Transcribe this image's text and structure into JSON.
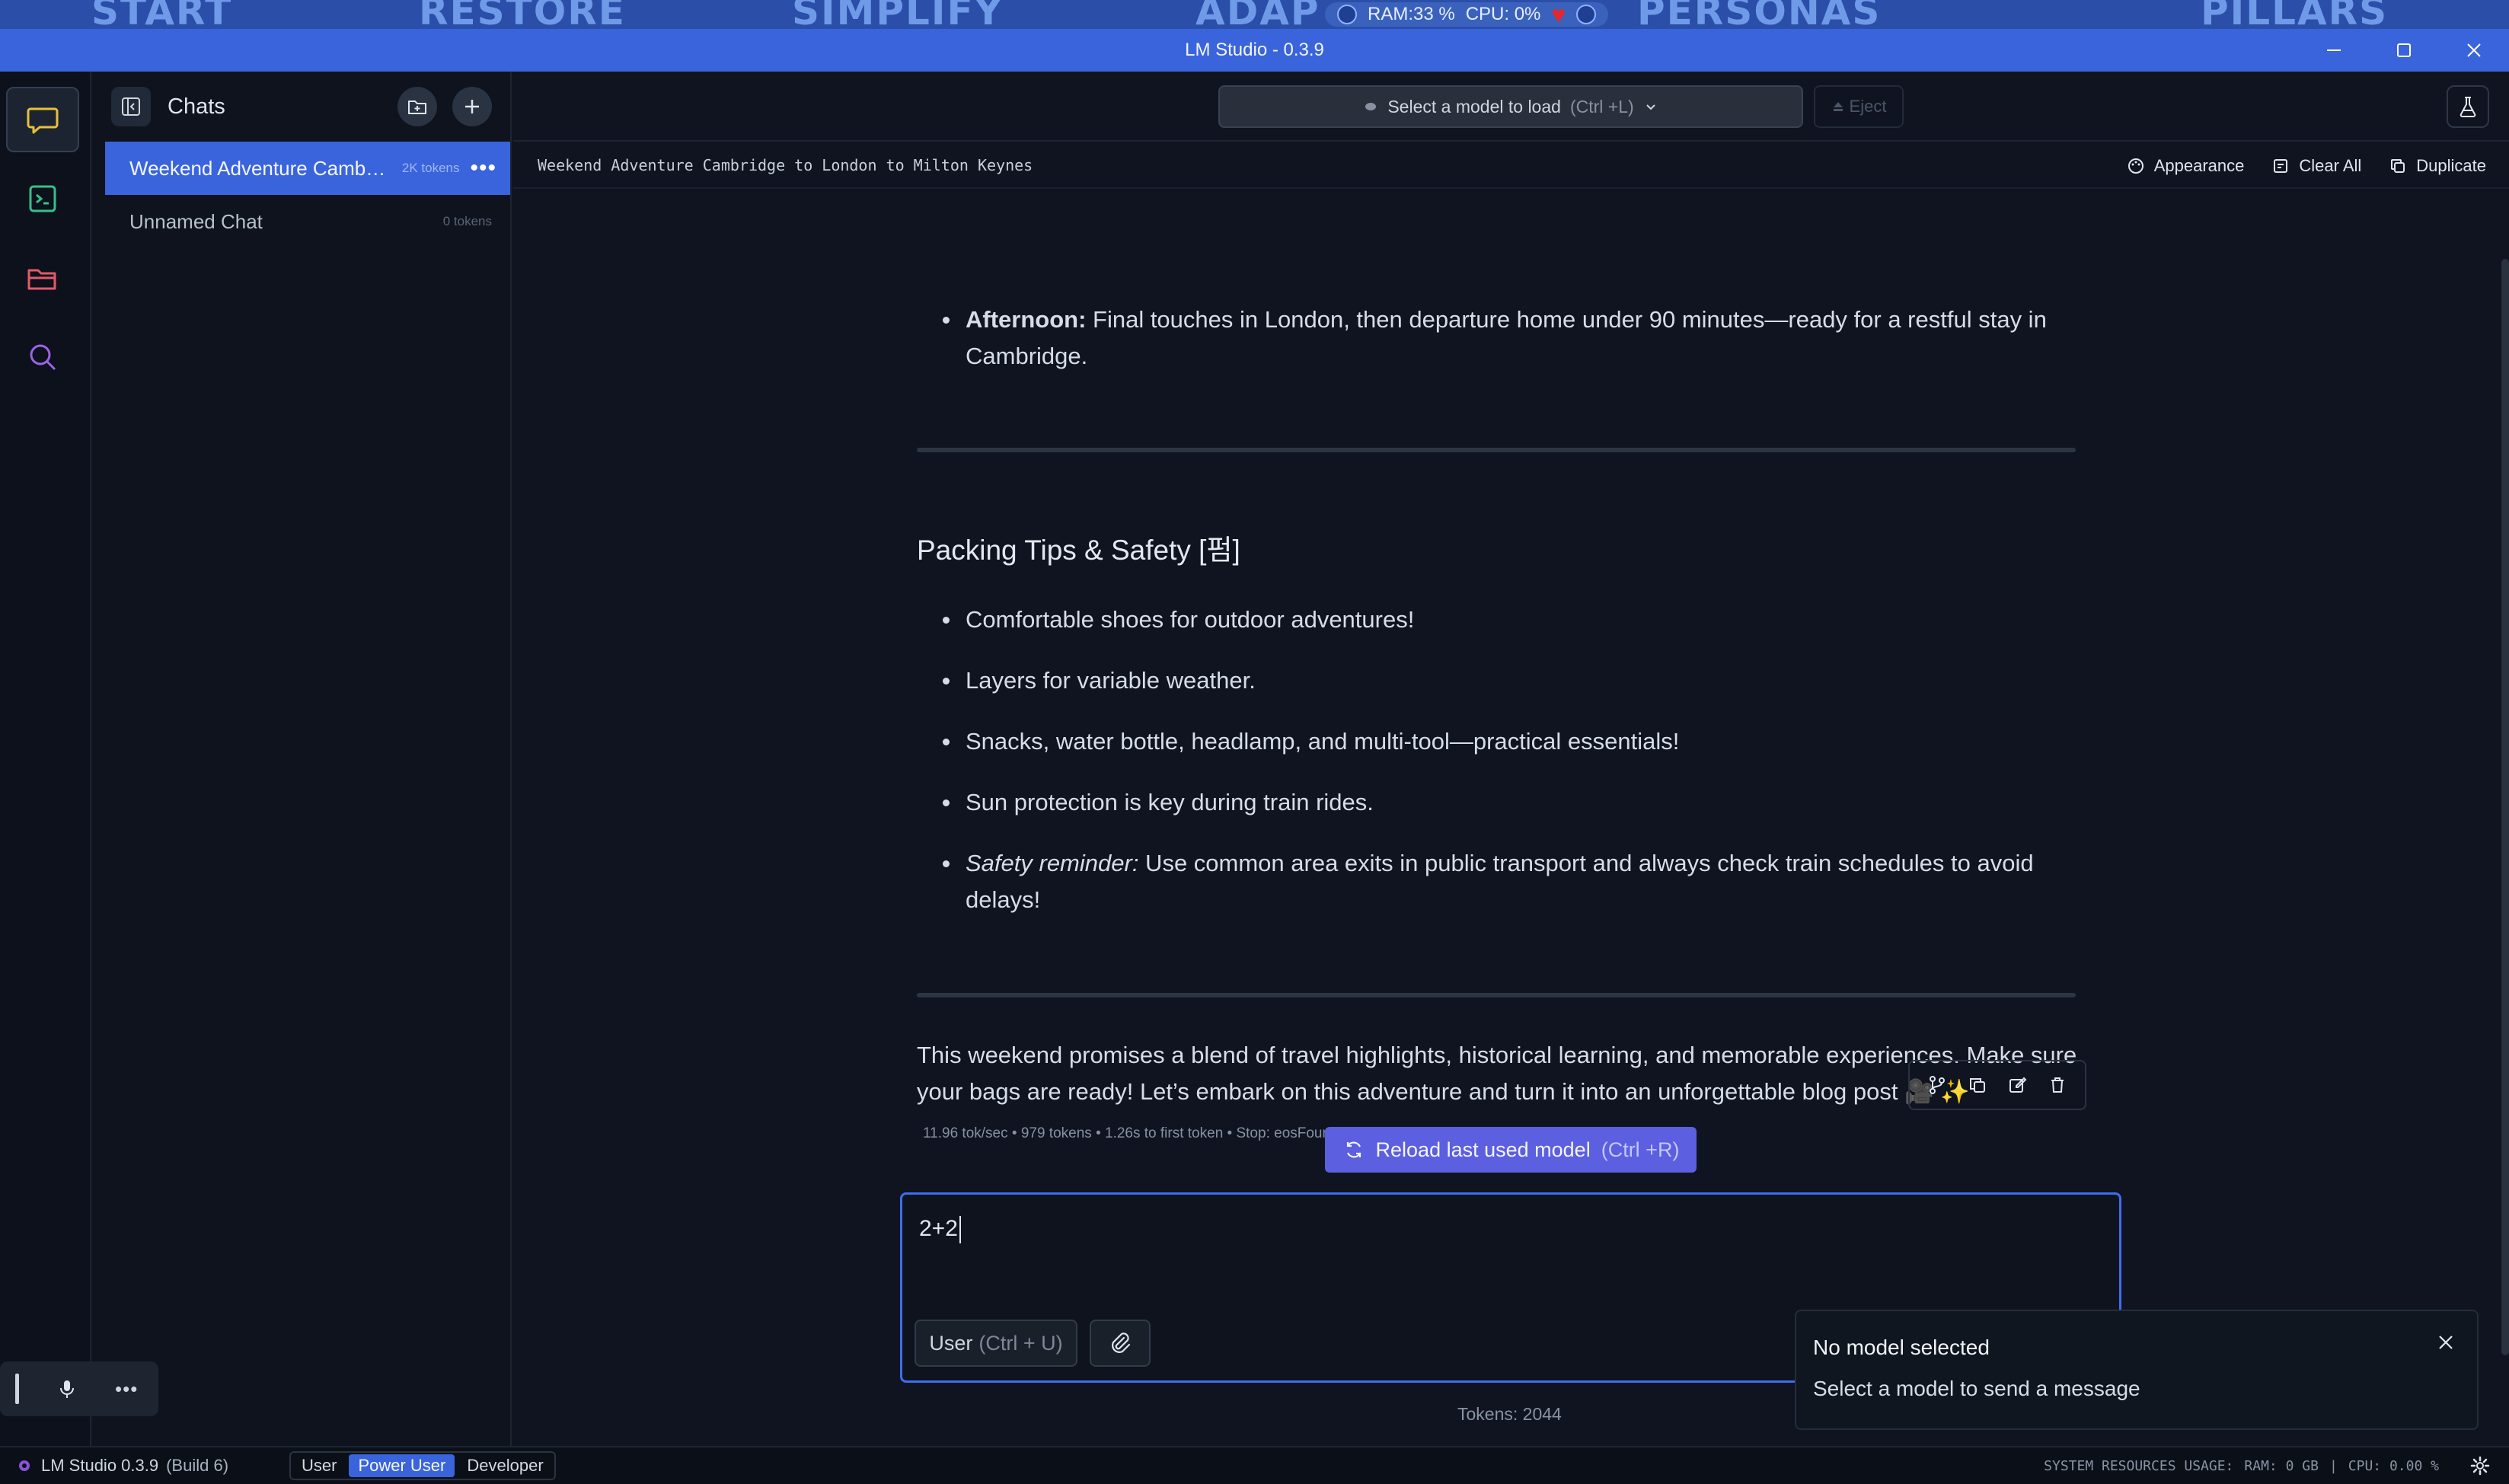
{
  "desktop": {
    "strip_words": [
      "START",
      "RESTORE",
      "SIMPLIFY",
      "ADAP",
      "PERSONAS",
      "PILLARS"
    ],
    "ram": "RAM:33 %",
    "cpu": "CPU: 0%"
  },
  "window": {
    "title": "LM Studio - 0.3.9"
  },
  "sidebar": {
    "title": "Chats",
    "chats": [
      {
        "name": "Weekend Adventure Cambri...",
        "tokens": "2K tokens",
        "active": true
      },
      {
        "name": "Unnamed Chat",
        "tokens": "0 tokens",
        "active": false
      }
    ]
  },
  "topbar": {
    "model_select_label": "Select a model to load",
    "model_select_hint": "(Ctrl +L)",
    "eject_label": "Eject"
  },
  "chat": {
    "title": "Weekend Adventure Cambridge to London to Milton Keynes",
    "actions": {
      "appearance": "Appearance",
      "clear_all": "Clear All",
      "duplicate": "Duplicate"
    }
  },
  "message": {
    "afternoon_label": "Afternoon:",
    "afternoon_text": " Final touches in London, then departure home under 90 minutes—ready for a restful stay in Cambridge.",
    "section_heading": "Packing Tips & Safety [펌]",
    "tips": [
      "Comfortable shoes for outdoor adventures!",
      "Layers for variable weather.",
      "Snacks, water bottle, headlamp, and multi-tool—practical essentials!",
      "Sun protection is key during train rides."
    ],
    "safety_label": "Safety reminder:",
    "safety_text": " Use common area exits in public transport and always check train schedules to avoid delays!",
    "closing": "This weekend promises a blend of travel highlights, historical learning, and memorable experiences. Make sure your bags are ready! Let’s embark on this adventure and turn it into an unforgettable blog post 🎥 ✨",
    "stats": {
      "speed": "11.96 tok/sec",
      "tokens": "979 tokens",
      "first_token": "1.26s to first token",
      "stop": "Stop: eosFound"
    }
  },
  "reload": {
    "label": "Reload last used model",
    "hint": "(Ctrl +R)"
  },
  "composer": {
    "value": "2+2",
    "role_label": "User",
    "role_hint": "(Ctrl + U)",
    "tokens": "Tokens: 2044"
  },
  "toast": {
    "title": "No model selected",
    "body": "Select a model to send a message"
  },
  "statusbar": {
    "app_name": "LM Studio 0.3.9",
    "build": "(Build 6)",
    "modes": [
      "User",
      "Power User",
      "Developer"
    ],
    "selected_mode": "Power User",
    "resources": "SYSTEM RESOURCES USAGE:",
    "ram": "RAM: 0 GB",
    "cpu": "CPU: 0.00 %"
  },
  "colors": {
    "accent": "#3a64dc",
    "reload": "#5b5fe0",
    "heart": "#e3262f"
  }
}
